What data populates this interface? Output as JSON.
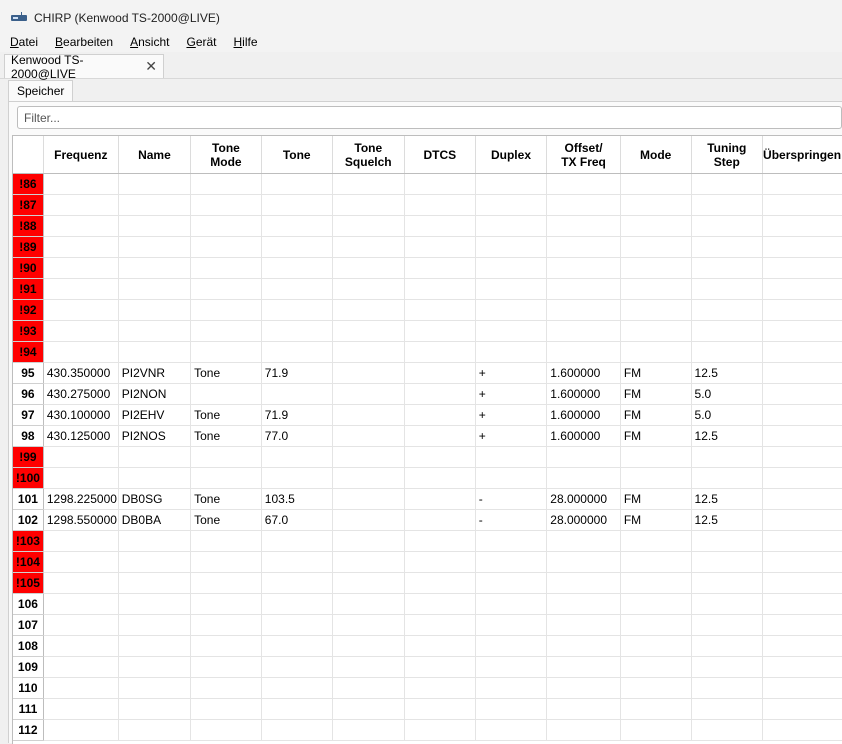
{
  "window": {
    "title": "CHIRP (Kenwood TS-2000@LIVE)",
    "icon": "radio-icon"
  },
  "menu": [
    {
      "u": "D",
      "rest": "atei"
    },
    {
      "u": "B",
      "rest": "earbeiten"
    },
    {
      "u": "A",
      "rest": "nsicht"
    },
    {
      "u": "G",
      "rest": "erät"
    },
    {
      "u": "H",
      "rest": "ilfe"
    }
  ],
  "tab": {
    "label": "Kenwood TS-2000@LIVE",
    "close": "✕"
  },
  "subtab": {
    "label": "Speicher"
  },
  "filter": {
    "placeholder": "Filter...",
    "value": ""
  },
  "columns": [
    {
      "key": "freq",
      "line1": "Frequenz",
      "line2": ""
    },
    {
      "key": "name",
      "line1": "Name",
      "line2": ""
    },
    {
      "key": "tmode",
      "line1": "Tone",
      "line2": "Mode"
    },
    {
      "key": "tone",
      "line1": "Tone",
      "line2": ""
    },
    {
      "key": "tsql",
      "line1": "Tone",
      "line2": "Squelch"
    },
    {
      "key": "dtcs",
      "line1": "DTCS",
      "line2": ""
    },
    {
      "key": "duplex",
      "line1": "Duplex",
      "line2": ""
    },
    {
      "key": "offset",
      "line1": "Offset/",
      "line2": "TX Freq"
    },
    {
      "key": "mode",
      "line1": "Mode",
      "line2": ""
    },
    {
      "key": "step",
      "line1": "Tuning",
      "line2": "Step"
    },
    {
      "key": "skip",
      "line1": "Überspringen",
      "line2": ""
    }
  ],
  "rows": [
    {
      "num": "!86",
      "err": true
    },
    {
      "num": "!87",
      "err": true
    },
    {
      "num": "!88",
      "err": true
    },
    {
      "num": "!89",
      "err": true
    },
    {
      "num": "!90",
      "err": true
    },
    {
      "num": "!91",
      "err": true
    },
    {
      "num": "!92",
      "err": true
    },
    {
      "num": "!93",
      "err": true
    },
    {
      "num": "!94",
      "err": true
    },
    {
      "num": "95",
      "err": false,
      "freq": "430.350000",
      "name": "PI2VNR",
      "tmode": "Tone",
      "tone": "71.9",
      "duplex": "+",
      "offset": "1.600000",
      "mode": "FM",
      "step": "12.5"
    },
    {
      "num": "96",
      "err": false,
      "freq": "430.275000",
      "name": "PI2NON",
      "duplex": "+",
      "offset": "1.600000",
      "mode": "FM",
      "step": "5.0"
    },
    {
      "num": "97",
      "err": false,
      "freq": "430.100000",
      "name": "PI2EHV",
      "tmode": "Tone",
      "tone": "71.9",
      "duplex": "+",
      "offset": "1.600000",
      "mode": "FM",
      "step": "5.0"
    },
    {
      "num": "98",
      "err": false,
      "freq": "430.125000",
      "name": "PI2NOS",
      "tmode": "Tone",
      "tone": "77.0",
      "duplex": "+",
      "offset": "1.600000",
      "mode": "FM",
      "step": "12.5"
    },
    {
      "num": "!99",
      "err": true
    },
    {
      "num": "!100",
      "err": true
    },
    {
      "num": "101",
      "err": false,
      "freq": "1298.225000",
      "name": "DB0SG",
      "tmode": "Tone",
      "tone": "103.5",
      "duplex": "-",
      "offset": "28.000000",
      "mode": "FM",
      "step": "12.5"
    },
    {
      "num": "102",
      "err": false,
      "freq": "1298.550000",
      "name": "DB0BA",
      "tmode": "Tone",
      "tone": "67.0",
      "duplex": "-",
      "offset": "28.000000",
      "mode": "FM",
      "step": "12.5"
    },
    {
      "num": "!103",
      "err": true
    },
    {
      "num": "!104",
      "err": true
    },
    {
      "num": "!105",
      "err": true
    },
    {
      "num": "106",
      "err": false
    },
    {
      "num": "107",
      "err": false
    },
    {
      "num": "108",
      "err": false
    },
    {
      "num": "109",
      "err": false
    },
    {
      "num": "110",
      "err": false
    },
    {
      "num": "111",
      "err": false
    },
    {
      "num": "112",
      "err": false
    }
  ]
}
